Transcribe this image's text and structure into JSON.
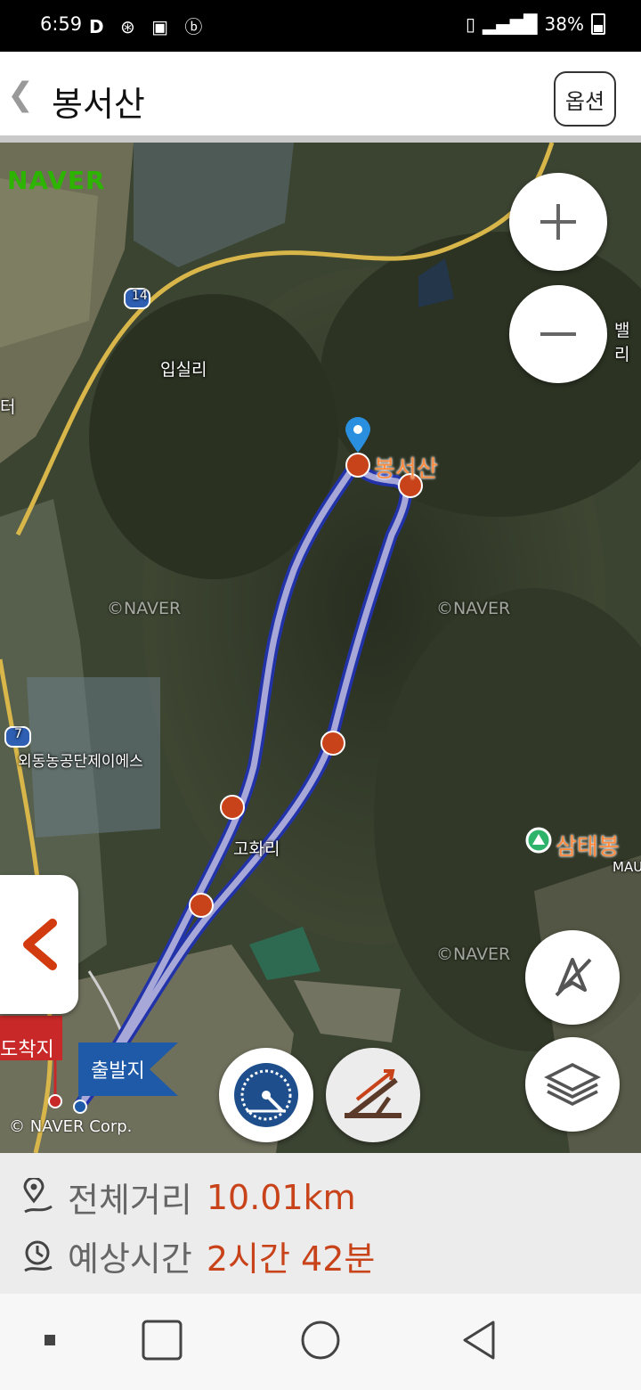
{
  "status_bar": {
    "time": "6:59",
    "left_icons": "D",
    "battery": "38%"
  },
  "header": {
    "back_icon": "chevron-left-icon",
    "title": "봉서산",
    "options_label": "옵션"
  },
  "map": {
    "logo": "NAVER",
    "copyright": "© NAVER Corp.",
    "watermark": "©NAVER",
    "labels": {
      "ipsil": "입실리",
      "gohwa": "고화리",
      "industrial": "외동농공단제이에스",
      "road_14": "14",
      "road_7": "7",
      "edge_left": "터",
      "edge_right_top": "밸리",
      "edge_right": "MAU"
    },
    "peak_main": "봉서산",
    "peak_other": "삼태봉",
    "flag_arrival": "도착지",
    "flag_departure": "출발지"
  },
  "summary": {
    "distance_label": "전체거리",
    "distance_value": "10.01km",
    "time_label": "예상시간",
    "time_value": "2시간 42분"
  },
  "colors": {
    "accent": "#c8431a",
    "route": "#a8a8d8",
    "route_outline": "#2233aa"
  }
}
